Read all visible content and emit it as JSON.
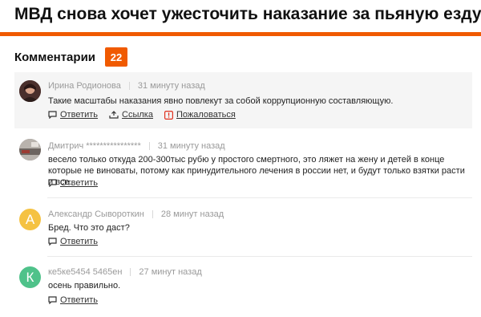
{
  "article": {
    "title": "МВД снова хочет ужесточить наказание за пьяную езду"
  },
  "comments_header": {
    "title": "Комментарии",
    "count": "22"
  },
  "comments": [
    {
      "author": "Ирина Родионова",
      "time": "31 минуту назад",
      "text": "Такие масштабы наказания явно повлекут за собой коррупционную составляющую.",
      "reply_label": "Ответить",
      "link_label": "Ссылка",
      "report_label": "Пожаловаться"
    },
    {
      "author": "Дмитрич ****************",
      "time": "31 минуту назад",
      "text": "весело только откуда 200-300тыс рубю у простого смертного, это ляжет на жену и детей в конце которые не виноваты, потому как принудительного лечения в россии нет, и будут только взятки расти и все.",
      "reply_label": "Ответить"
    },
    {
      "author": "Александр Сыворот​кин",
      "time": "28 минут назад",
      "avatar_letter": "А",
      "text": "Бред. Что это даст?",
      "reply_label": "Ответить"
    },
    {
      "author": "ке5ке5454 5465ен",
      "time": "27 минут назад",
      "avatar_letter": "К",
      "text": "осень правильно.",
      "reply_label": "Ответить"
    }
  ],
  "colors": {
    "accent": "#f05a00",
    "avatar_a": "#f5c242",
    "avatar_k": "#4fc28a",
    "report": "#e0311f"
  }
}
